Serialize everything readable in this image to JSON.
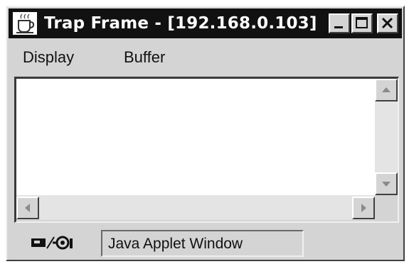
{
  "window": {
    "title": "Trap Frame - [192.168.0.103]"
  },
  "menu": {
    "items": [
      {
        "label": "Display"
      },
      {
        "label": "Buffer"
      }
    ]
  },
  "status": {
    "text": "Java Applet Window"
  },
  "icons": {
    "app": "java-cup-icon",
    "minimize": "minimize-icon",
    "maximize": "maximize-icon",
    "close": "close-icon",
    "scroll_up": "arrow-up-icon",
    "scroll_down": "arrow-down-icon",
    "scroll_left": "arrow-left-icon",
    "scroll_right": "arrow-right-icon",
    "applet_warning": "applet-key-icon"
  },
  "colors": {
    "title_bar": "#111111",
    "title_text": "#ffffff",
    "window_face": "#d4d4d4",
    "text_area": "#ffffff"
  }
}
